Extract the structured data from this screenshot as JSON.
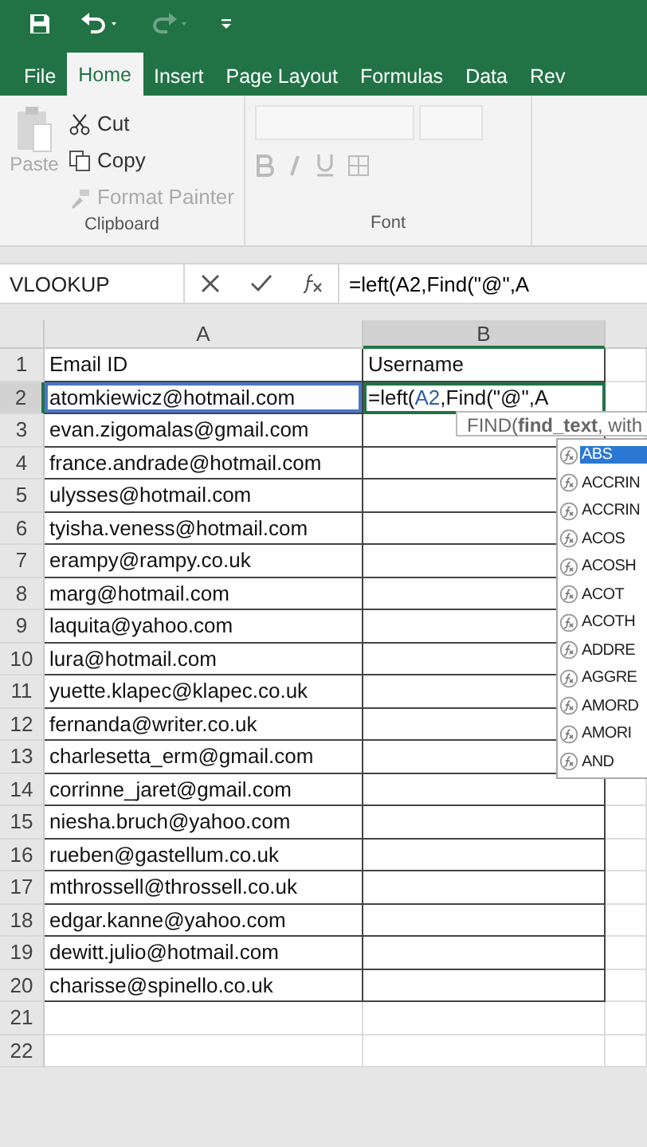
{
  "quick_access": {
    "undo_enabled": true,
    "redo_enabled": false
  },
  "tabs": [
    {
      "label": "File",
      "selected": false
    },
    {
      "label": "Home",
      "selected": true
    },
    {
      "label": "Insert",
      "selected": false
    },
    {
      "label": "Page Layout",
      "selected": false
    },
    {
      "label": "Formulas",
      "selected": false
    },
    {
      "label": "Data",
      "selected": false
    },
    {
      "label": "Rev",
      "selected": false
    }
  ],
  "clipboard": {
    "title": "Clipboard",
    "paste": {
      "label": "Paste",
      "disabled": true
    },
    "items": [
      {
        "kind": "cut",
        "label": "Cut",
        "disabled": false
      },
      {
        "kind": "copy",
        "label": "Copy",
        "disabled": false
      },
      {
        "kind": "painter",
        "label": "Format Painter",
        "disabled": true
      }
    ]
  },
  "font_group": {
    "title": "Font",
    "disabled": true
  },
  "formula_bar": {
    "name_box": "VLOOKUP",
    "formula": "=left(A2,Find(\"@\",A"
  },
  "columns": [
    {
      "label": "A",
      "selected": false
    },
    {
      "label": "B",
      "selected": true
    }
  ],
  "rows": [
    {
      "num": "1",
      "selected": false,
      "a": "Email ID",
      "b": "Username"
    },
    {
      "num": "2",
      "selected": true,
      "a": "atomkiewicz@hotmail.com",
      "b_parts": [
        {
          "text": "=left(",
          "ref": false
        },
        {
          "text": "A2",
          "ref": true
        },
        {
          "text": ",Find(\"@\",A",
          "ref": false
        }
      ]
    },
    {
      "num": "3",
      "selected": false,
      "a": "evan.zigomalas@gmail.com"
    },
    {
      "num": "4",
      "selected": false,
      "a": "france.andrade@hotmail.com"
    },
    {
      "num": "5",
      "selected": false,
      "a": "ulysses@hotmail.com"
    },
    {
      "num": "6",
      "selected": false,
      "a": "tyisha.veness@hotmail.com"
    },
    {
      "num": "7",
      "selected": false,
      "a": "erampy@rampy.co.uk"
    },
    {
      "num": "8",
      "selected": false,
      "a": "marg@hotmail.com"
    },
    {
      "num": "9",
      "selected": false,
      "a": "laquita@yahoo.com"
    },
    {
      "num": "10",
      "selected": false,
      "a": "lura@hotmail.com"
    },
    {
      "num": "11",
      "selected": false,
      "a": "yuette.klapec@klapec.co.uk"
    },
    {
      "num": "12",
      "selected": false,
      "a": "fernanda@writer.co.uk"
    },
    {
      "num": "13",
      "selected": false,
      "a": "charlesetta_erm@gmail.com"
    },
    {
      "num": "14",
      "selected": false,
      "a": "corrinne_jaret@gmail.com"
    },
    {
      "num": "15",
      "selected": false,
      "a": "niesha.bruch@yahoo.com"
    },
    {
      "num": "16",
      "selected": false,
      "a": "rueben@gastellum.co.uk"
    },
    {
      "num": "17",
      "selected": false,
      "a": "mthrossell@throssell.co.uk"
    },
    {
      "num": "18",
      "selected": false,
      "a": "edgar.kanne@yahoo.com"
    },
    {
      "num": "19",
      "selected": false,
      "a": "dewitt.julio@hotmail.com"
    },
    {
      "num": "20",
      "selected": false,
      "a": "charisse@spinello.co.uk"
    },
    {
      "num": "21",
      "selected": false
    },
    {
      "num": "22",
      "selected": false
    }
  ],
  "tooltip": "FIND(**find_text**, with",
  "autocomplete": [
    {
      "label": "ABS",
      "selected": true
    },
    {
      "label": "ACCRIN",
      "selected": false
    },
    {
      "label": "ACCRIN",
      "selected": false
    },
    {
      "label": "ACOS",
      "selected": false
    },
    {
      "label": "ACOSH",
      "selected": false
    },
    {
      "label": "ACOT",
      "selected": false
    },
    {
      "label": "ACOTH",
      "selected": false
    },
    {
      "label": "ADDRE",
      "selected": false
    },
    {
      "label": "AGGRE",
      "selected": false
    },
    {
      "label": "AMORD",
      "selected": false
    },
    {
      "label": "AMORI",
      "selected": false
    },
    {
      "label": "AND",
      "selected": false
    }
  ]
}
